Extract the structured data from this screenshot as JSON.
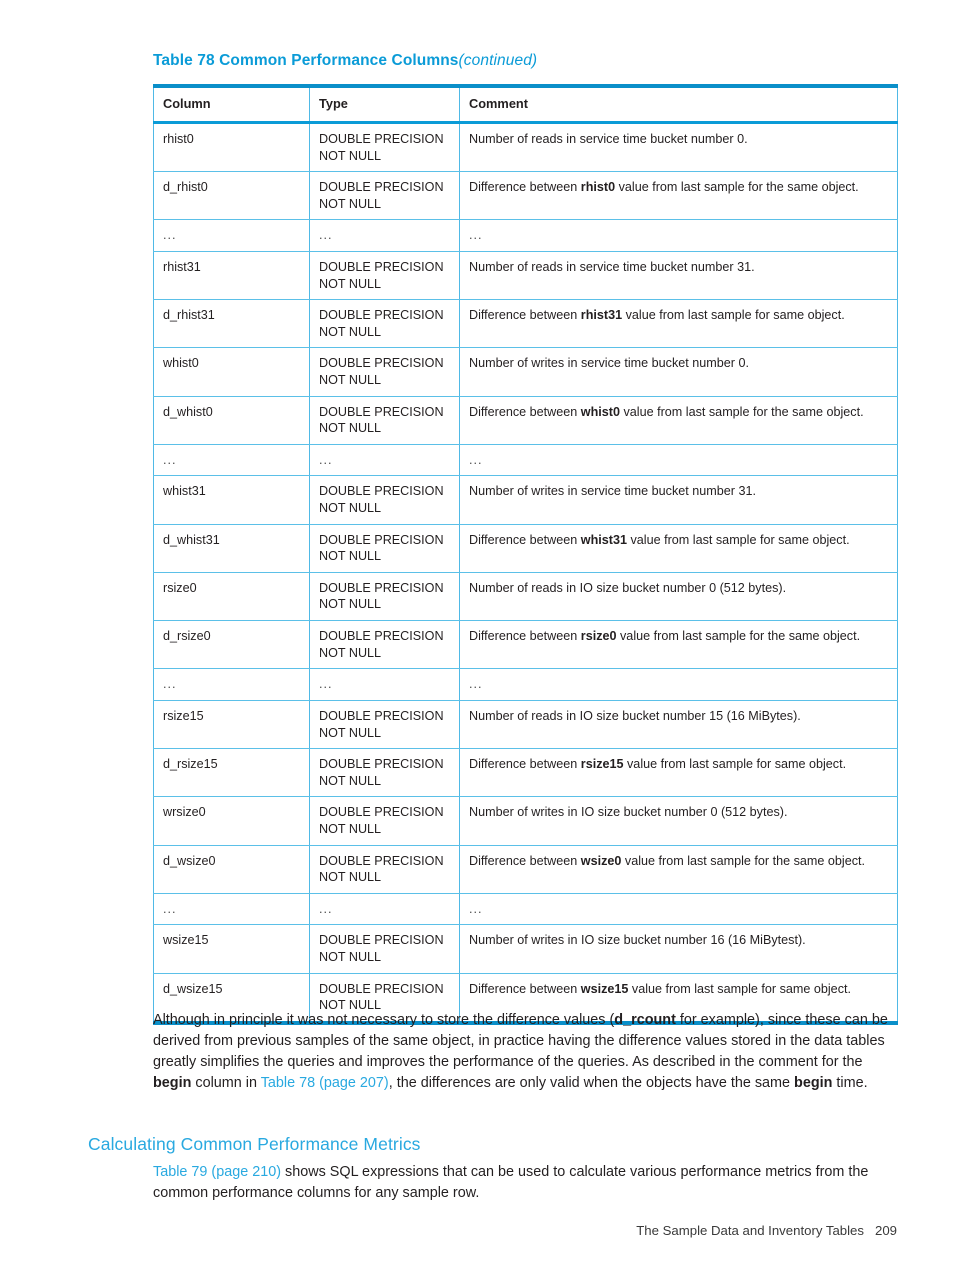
{
  "table": {
    "caption_main": "Table 78 Common Performance Columns",
    "caption_continued": "(continued)",
    "headers": [
      "Column",
      "Type",
      "Comment"
    ],
    "rows": [
      {
        "column": "rhist0",
        "type": "DOUBLE PRECISION\nNOT NULL",
        "comment_pre": "Number of reads in service time bucket number 0.",
        "comment_bold": "",
        "comment_post": ""
      },
      {
        "column": "d_rhist0",
        "type": "DOUBLE PRECISION\nNOT NULL",
        "comment_pre": "Difference between ",
        "comment_bold": "rhist0",
        "comment_post": " value from last sample for the same object."
      },
      {
        "column": "...",
        "type": "...",
        "comment_pre": "...",
        "comment_bold": "",
        "comment_post": ""
      },
      {
        "column": "rhist31",
        "type": "DOUBLE PRECISION\nNOT NULL",
        "comment_pre": "Number of reads in service time bucket number 31.",
        "comment_bold": "",
        "comment_post": ""
      },
      {
        "column": "d_rhist31",
        "type": "DOUBLE PRECISION\nNOT NULL",
        "comment_pre": "Difference between ",
        "comment_bold": "rhist31",
        "comment_post": " value from last sample for same object."
      },
      {
        "column": "whist0",
        "type": "DOUBLE PRECISION\nNOT NULL",
        "comment_pre": "Number of writes in service time bucket number 0.",
        "comment_bold": "",
        "comment_post": ""
      },
      {
        "column": "d_whist0",
        "type": "DOUBLE PRECISION\nNOT NULL",
        "comment_pre": "Difference between ",
        "comment_bold": "whist0",
        "comment_post": " value from last sample for the same object."
      },
      {
        "column": "...",
        "type": "...",
        "comment_pre": "...",
        "comment_bold": "",
        "comment_post": ""
      },
      {
        "column": "whist31",
        "type": "DOUBLE PRECISION\nNOT NULL",
        "comment_pre": "Number of writes in service time bucket number 31.",
        "comment_bold": "",
        "comment_post": ""
      },
      {
        "column": "d_whist31",
        "type": "DOUBLE PRECISION\nNOT NULL",
        "comment_pre": "Difference between ",
        "comment_bold": "whist31",
        "comment_post": " value from last sample for same object."
      },
      {
        "column": "rsize0",
        "type": "DOUBLE PRECISION\nNOT NULL",
        "comment_pre": "Number of reads in IO size bucket number 0 (512 bytes).",
        "comment_bold": "",
        "comment_post": ""
      },
      {
        "column": "d_rsize0",
        "type": "DOUBLE PRECISION\nNOT NULL",
        "comment_pre": "Difference between ",
        "comment_bold": "rsize0",
        "comment_post": " value from last sample for the same object."
      },
      {
        "column": "...",
        "type": "...",
        "comment_pre": "...",
        "comment_bold": "",
        "comment_post": ""
      },
      {
        "column": "rsize15",
        "type": "DOUBLE PRECISION\nNOT NULL",
        "comment_pre": "Number of reads in IO size bucket number 15 (16 MiBytes).",
        "comment_bold": "",
        "comment_post": ""
      },
      {
        "column": "d_rsize15",
        "type": "DOUBLE PRECISION\nNOT NULL",
        "comment_pre": "Difference between ",
        "comment_bold": "rsize15",
        "comment_post": " value from last sample for same object."
      },
      {
        "column": "wrsize0",
        "type": "DOUBLE PRECISION\nNOT NULL",
        "comment_pre": "Number of writes in IO size bucket number 0 (512 bytes).",
        "comment_bold": "",
        "comment_post": ""
      },
      {
        "column": "d_wsize0",
        "type": "DOUBLE PRECISION\nNOT NULL",
        "comment_pre": "Difference between ",
        "comment_bold": "wsize0",
        "comment_post": " value from last sample for the same object."
      },
      {
        "column": "...",
        "type": "...",
        "comment_pre": "...",
        "comment_bold": "",
        "comment_post": ""
      },
      {
        "column": "wsize15",
        "type": "DOUBLE PRECISION\nNOT NULL",
        "comment_pre": "Number of writes in IO size bucket number 16 (16 MiBytest).",
        "comment_bold": "",
        "comment_post": ""
      },
      {
        "column": "d_wsize15",
        "type": "DOUBLE PRECISION\nNOT NULL",
        "comment_pre": "Difference between ",
        "comment_bold": "wsize15",
        "comment_post": " value from last sample for same object."
      }
    ]
  },
  "paragraphs": {
    "difference": {
      "s1": "Although in principle it was not necessary to store the difference values (",
      "b1": "d_rcount",
      "s2": " for example), since these can be derived from previous samples of the same object, in practice having the difference values stored in the data tables greatly simplifies the queries and improves the performance of the queries. As described in the comment for the ",
      "b2": "begin",
      "s3": " column in ",
      "link1": "Table 78 (page 207)",
      "s4": ", the differences are only valid when the objects have the same ",
      "b3": "begin",
      "s5": " time."
    },
    "metrics": {
      "link1": "Table 79 (page 210)",
      "s1": " shows SQL expressions that can be used to calculate various performance metrics from the common performance columns for any sample row."
    }
  },
  "section_heading": "Calculating Common Performance Metrics",
  "footer": {
    "title": "The Sample Data and Inventory Tables",
    "page_number": "209"
  },
  "colors": {
    "accent_blue": "#29a9e0",
    "caption_blue": "#0a9bd7",
    "rule_blue": "#5bc0e8",
    "heavy_rule_blue": "#0a8fc9",
    "text": "#231f20"
  }
}
